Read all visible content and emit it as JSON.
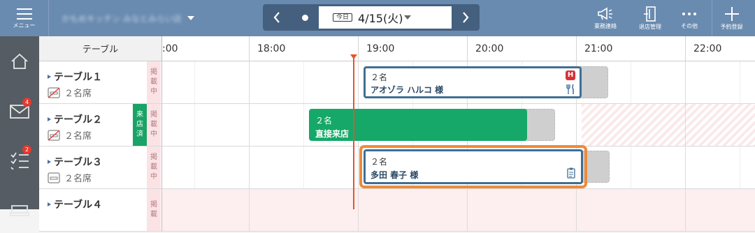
{
  "topbar": {
    "menu_label": "メニュー",
    "store_name": "かもめキッチン みなとみらい店",
    "today_label": "今日",
    "date": "4/15(火)",
    "notice_label": "業務連絡",
    "visit_label": "退店管理",
    "more_label": "その他",
    "add_label": "予約登録",
    "bg_color": "#6a8bb0"
  },
  "sidebar": {
    "items": [
      {
        "icon": "home-icon"
      },
      {
        "icon": "mail-icon",
        "badge": "4"
      },
      {
        "icon": "checklist-icon",
        "badge": "2"
      },
      {
        "icon": "store-icon"
      }
    ]
  },
  "timeline": {
    "table_header": "テーブル",
    "hours": [
      ":00",
      "18:00",
      "19:00",
      "20:00",
      "21:00",
      "22:00"
    ],
    "current_time_color": "#e4552e"
  },
  "rows": [
    {
      "name": "テーブル１",
      "seats": "２名席",
      "status": [
        "掲",
        "載",
        "中"
      ]
    },
    {
      "name": "テーブル２",
      "seats": "２名席",
      "visited": [
        "来",
        "店",
        "済"
      ],
      "status": [
        "掲",
        "載",
        "中"
      ]
    },
    {
      "name": "テーブル３",
      "seats": "２名席",
      "status": [
        "掲",
        "載",
        "中"
      ]
    },
    {
      "name": "テーブル４",
      "seats": "",
      "status": [
        "掲",
        "載"
      ]
    }
  ],
  "reservations": [
    {
      "party": "２名",
      "guest": "アオゾラ ハルコ 様",
      "color": "#3f6f94"
    },
    {
      "party": "２名",
      "guest": "直接来店",
      "color": "#16a868"
    },
    {
      "party": "２名",
      "guest": "多田 春子 様",
      "color": "#3f6f94",
      "selected_color": "#ef8a38"
    }
  ]
}
